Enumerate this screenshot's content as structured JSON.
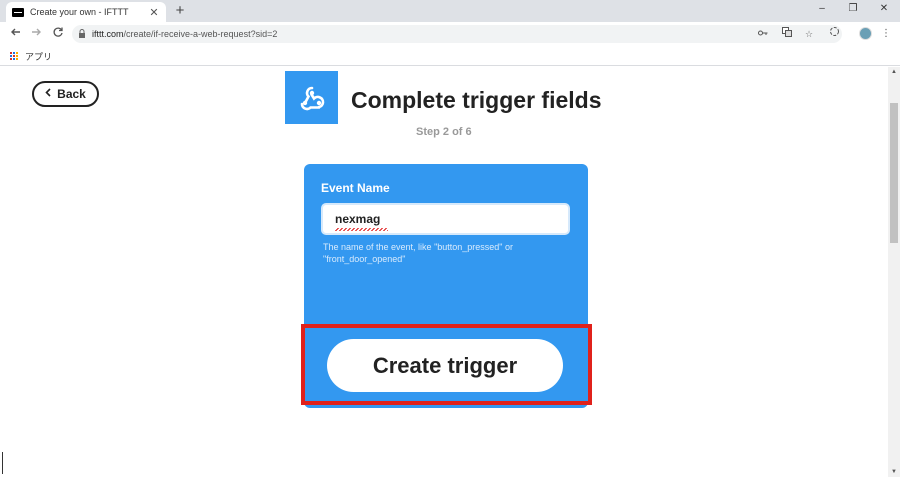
{
  "browser": {
    "tab": {
      "title": "Create your own - IFTTT",
      "close_glyph": "✕"
    },
    "new_tab_glyph": "+",
    "window_controls": [
      "–",
      "❐",
      "✕"
    ],
    "url": {
      "host": "ifttt.com",
      "path": "/create/if-receive-a-web-request?sid=2"
    },
    "bookmarks": {
      "apps_label": "アプリ"
    }
  },
  "page": {
    "back_label": "Back",
    "back_glyph": "‹",
    "heading": "Complete trigger fields",
    "step": "Step 2 of 6",
    "service_icon": "webhooks-icon",
    "form": {
      "field_label": "Event Name",
      "field_value": "nexmag",
      "helper_text": "The name of the event, like \"button_pressed\" or \"front_door_opened\"",
      "submit_label": "Create trigger"
    }
  },
  "colors": {
    "card_blue": "#3398f0",
    "highlight_red": "#e0211b"
  }
}
